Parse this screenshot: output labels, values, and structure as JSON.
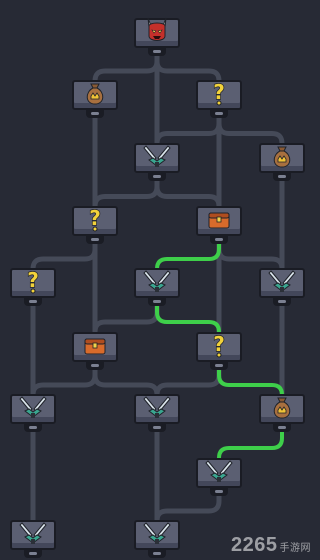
{
  "colors": {
    "background": "#272a35",
    "path": "#454a58",
    "active_path": "#3ecf4a",
    "node": "#5b5f72"
  },
  "map": {
    "nodes": [
      {
        "id": "boss",
        "type": "boss",
        "icon": "demon-icon"
      },
      {
        "id": "r1a",
        "type": "treasure_bag",
        "icon": "money-bag-icon"
      },
      {
        "id": "r1b",
        "type": "unknown",
        "icon": "question-icon",
        "label": "?"
      },
      {
        "id": "r2a",
        "type": "battle",
        "icon": "crossed-swords-icon"
      },
      {
        "id": "r2b",
        "type": "treasure_bag",
        "icon": "money-bag-icon"
      },
      {
        "id": "r3a",
        "type": "unknown",
        "icon": "question-icon",
        "label": "?"
      },
      {
        "id": "r3b",
        "type": "chest",
        "icon": "chest-icon"
      },
      {
        "id": "r4a",
        "type": "unknown",
        "icon": "question-icon",
        "label": "?"
      },
      {
        "id": "r4b",
        "type": "battle",
        "icon": "crossed-swords-icon"
      },
      {
        "id": "r4c",
        "type": "battle",
        "icon": "crossed-swords-icon"
      },
      {
        "id": "r5a",
        "type": "chest",
        "icon": "chest-icon"
      },
      {
        "id": "r5b",
        "type": "unknown",
        "icon": "question-icon",
        "label": "?"
      },
      {
        "id": "r6a",
        "type": "battle",
        "icon": "crossed-swords-icon"
      },
      {
        "id": "r6b",
        "type": "battle",
        "icon": "crossed-swords-icon"
      },
      {
        "id": "r6c",
        "type": "treasure_bag",
        "icon": "money-bag-icon"
      },
      {
        "id": "r7a",
        "type": "battle",
        "icon": "crossed-swords-icon"
      },
      {
        "id": "r8a",
        "type": "battle",
        "icon": "crossed-swords-icon"
      },
      {
        "id": "r8b",
        "type": "battle",
        "icon": "crossed-swords-icon"
      }
    ],
    "links": [
      [
        "boss",
        "r1a"
      ],
      [
        "boss",
        "r1b"
      ],
      [
        "boss",
        "r2a"
      ],
      [
        "r1a",
        "r3a"
      ],
      [
        "r1b",
        "r2a"
      ],
      [
        "r1b",
        "r3b"
      ],
      [
        "r1b",
        "r2b"
      ],
      [
        "r2a",
        "r3a"
      ],
      [
        "r2a",
        "r3b"
      ],
      [
        "r2b",
        "r4c"
      ],
      [
        "r3b",
        "r4c"
      ],
      [
        "r3a",
        "r4a"
      ],
      [
        "r3a",
        "r5a"
      ],
      [
        "r3b",
        "r4b"
      ],
      [
        "r3b",
        "r5b"
      ],
      [
        "r4a",
        "r6a"
      ],
      [
        "r4b",
        "r5a"
      ],
      [
        "r4b",
        "r5b"
      ],
      [
        "r4c",
        "r6c"
      ],
      [
        "r5a",
        "r6a"
      ],
      [
        "r5a",
        "r6b"
      ],
      [
        "r5b",
        "r6b"
      ],
      [
        "r5b",
        "r6c"
      ],
      [
        "r6a",
        "r8a"
      ],
      [
        "r6b",
        "r8b"
      ],
      [
        "r6c",
        "r7a"
      ],
      [
        "r7a",
        "r8b"
      ]
    ],
    "active_path": [
      [
        "r3b",
        "r4b"
      ],
      [
        "r4b",
        "r5b"
      ],
      [
        "r5b",
        "r6c"
      ],
      [
        "r6c",
        "r7a"
      ]
    ]
  },
  "watermark": {
    "text": "2265",
    "suffix": "手游网"
  }
}
